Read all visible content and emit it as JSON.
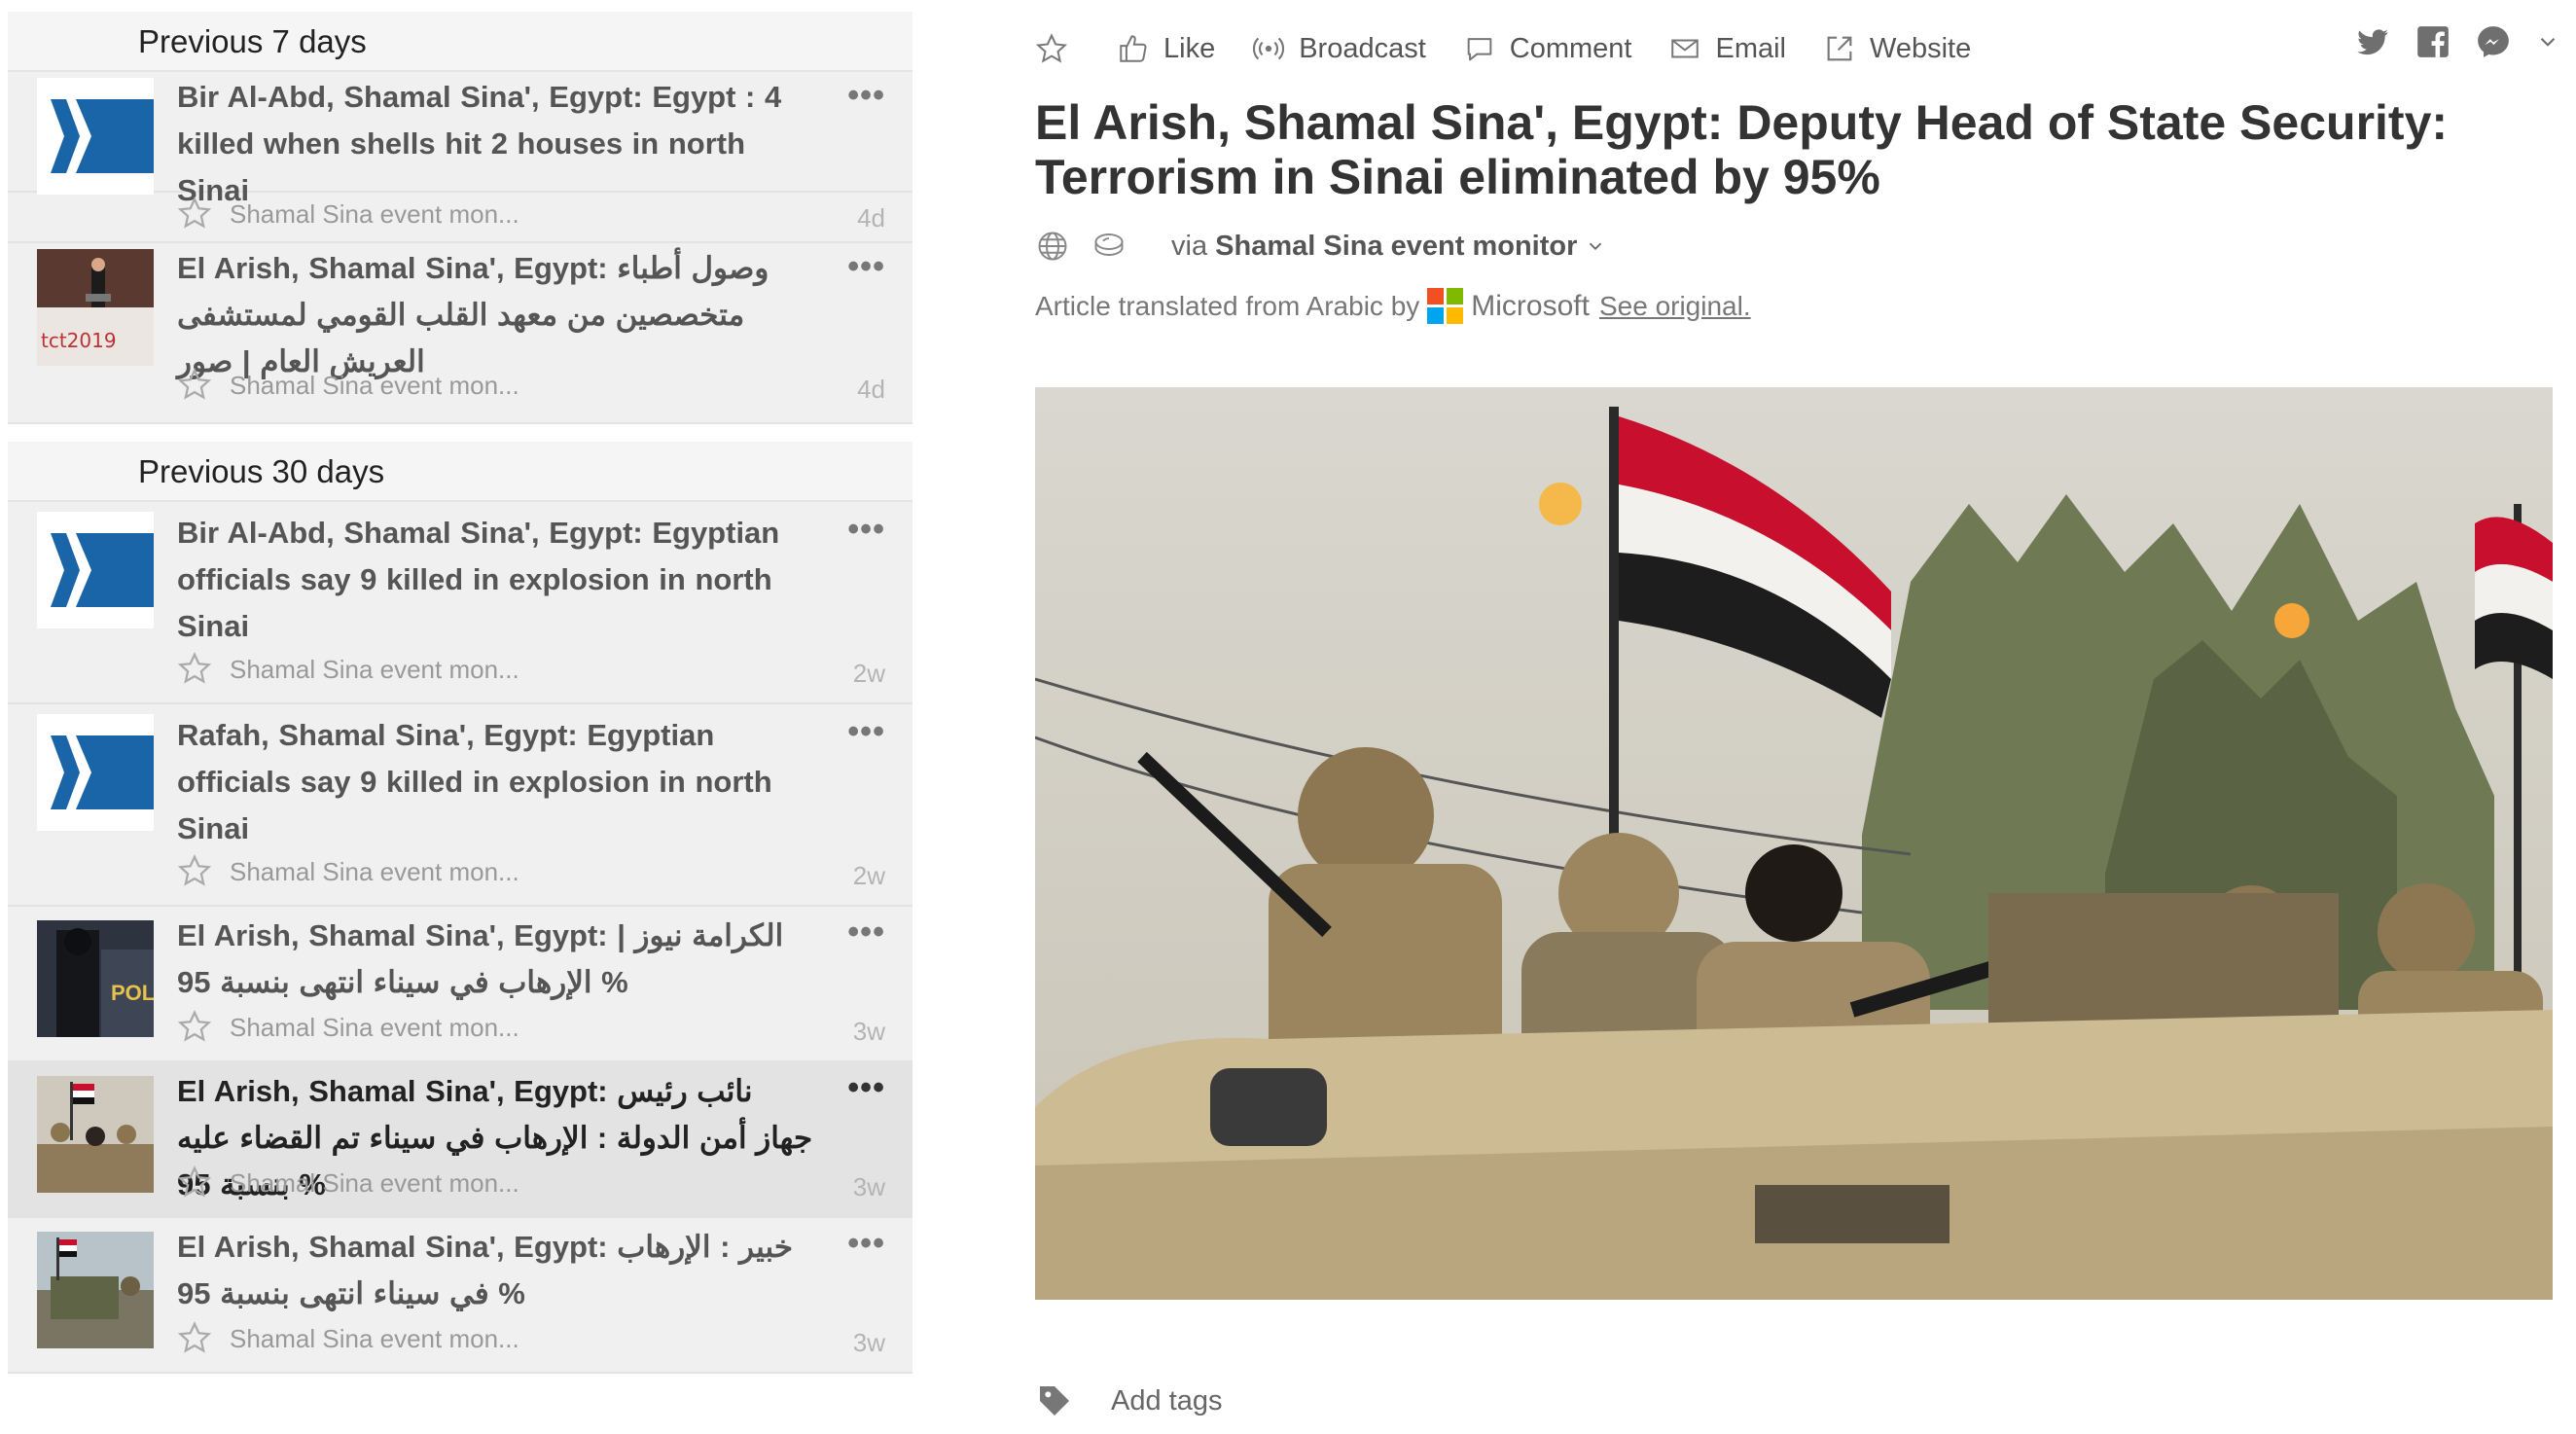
{
  "feed": {
    "sections": [
      {
        "header": "Previous 7 days",
        "items": [
          {
            "title": "Bir Al-Abd, Shamal Sina', Egypt: Egypt : 4 killed when shells hit 2 houses in north Sinai",
            "source": "Shamal Sina event mon...",
            "age": "4d",
            "thumb": "logo"
          },
          {
            "title": "El Arish, Shamal Sina', Egypt: وصول أطباء متخصصين من معهد القلب القومي لمستشفى العريش العام | صور",
            "source": "Shamal Sina event mon...",
            "age": "4d",
            "thumb": "tct",
            "thumb_text": "tct2019"
          }
        ]
      },
      {
        "header": "Previous 30 days",
        "items": [
          {
            "title": "Bir Al-Abd, Shamal Sina', Egypt: Egyptian officials say 9 killed in explosion in north Sinai",
            "source": "Shamal Sina event mon...",
            "age": "2w",
            "thumb": "logo"
          },
          {
            "title": "Rafah, Shamal Sina', Egypt: Egyptian officials say 9 killed in explosion in north Sinai",
            "source": "Shamal Sina event mon...",
            "age": "2w",
            "thumb": "logo"
          },
          {
            "title": "El Arish, Shamal Sina', Egypt: الكرامة نيوز | الإرهاب في سيناء انتهى بنسبة 95 %",
            "source": "Shamal Sina event mon...",
            "age": "3w",
            "thumb": "police",
            "thumb_text": "POLI"
          },
          {
            "title": "El Arish, Shamal Sina', Egypt: نائب رئيس جهاز أمن الدولة : الإرهاب في سيناء تم القضاء عليه بنسبة 95 %",
            "source": "Shamal Sina event mon...",
            "age": "3w",
            "thumb": "soldiers",
            "selected": true
          },
          {
            "title": "El Arish, Shamal Sina', Egypt: خبير : الإرهاب في سيناء انتهى بنسبة 95 %",
            "source": "Shamal Sina event mon...",
            "age": "3w",
            "thumb": "vehicle"
          }
        ]
      }
    ],
    "more_glyph": "•••"
  },
  "article": {
    "toolbar": {
      "like": "Like",
      "broadcast": "Broadcast",
      "comment": "Comment",
      "email": "Email",
      "website": "Website"
    },
    "headline": "El Arish, Shamal Sina', Egypt: Deputy Head of State Security: Terrorism in Sinai eliminated by 95%",
    "via_prefix": "via",
    "source_name": "Shamal Sina event monitor",
    "translated_prefix": "Article translated from Arabic by",
    "translator": "Microsoft",
    "see_original": "See original.",
    "add_tags": "Add tags"
  },
  "colors": {
    "logo_blue": "#1a64a8",
    "ms_red": "#f25022",
    "ms_green": "#7fba00",
    "ms_blue": "#00a4ef",
    "ms_yellow": "#ffb900"
  },
  "icons": [
    "star-icon",
    "like-icon",
    "broadcast-icon",
    "comment-icon",
    "email-icon",
    "website-icon",
    "twitter-icon",
    "facebook-icon",
    "messenger-icon",
    "chevron-down-icon",
    "globe-icon",
    "feed-source-icon",
    "tag-icon",
    "more-icon"
  ]
}
